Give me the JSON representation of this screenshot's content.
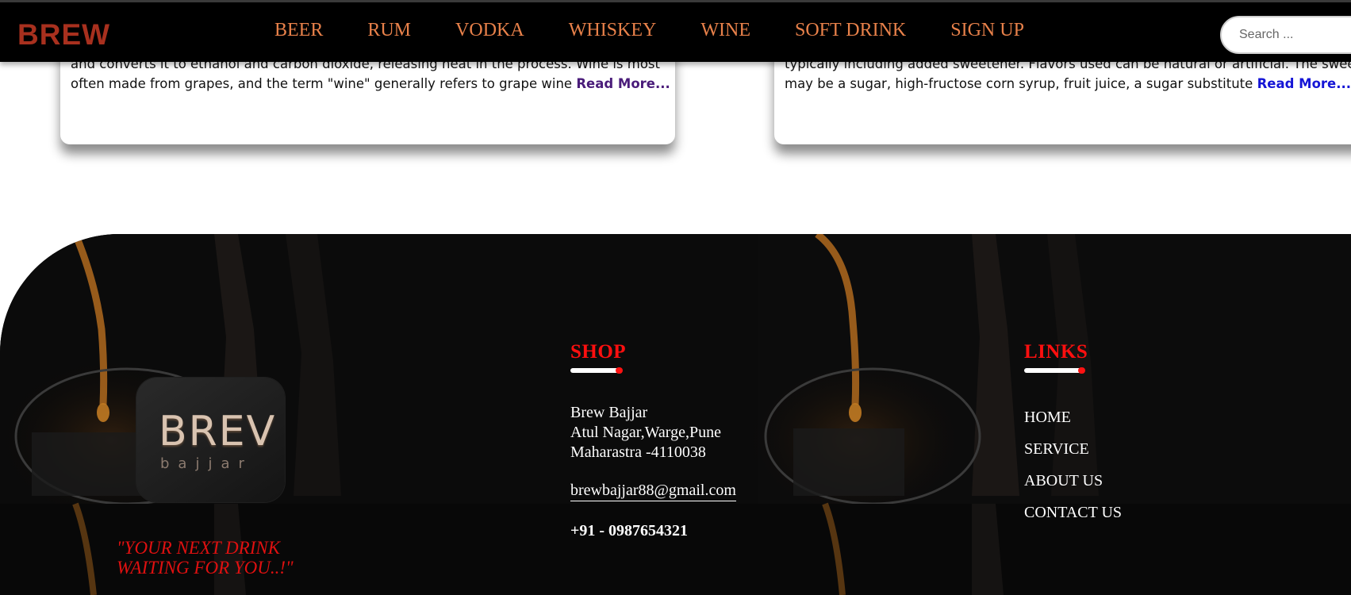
{
  "navbar": {
    "brand": "BREW",
    "links": [
      "BEER",
      "RUM",
      "VODKA",
      "WHISKEY",
      "WINE",
      "SOFT DRINK",
      "SIGN UP"
    ],
    "search_placeholder": "Search ..."
  },
  "cards": {
    "left": {
      "line1": "and converts it to ethanol and carbon dioxide, releasing heat in the process. Wine is most",
      "line2": "often made from grapes, and the term \"wine\" generally refers to grape wine",
      "read_more": "Read More..."
    },
    "right": {
      "line1": "typically including added sweetener. Flavors used can be natural or artificial. The sweetener",
      "line2": "may be a sugar, high-fructose corn syrup, fruit juice, a sugar substitute",
      "read_more": "Read More..."
    }
  },
  "footer": {
    "logo_main": "BREV",
    "logo_sub": "bajjar",
    "tagline_line1": "\"YOUR NEXT DRINK",
    "tagline_line2": "WAITING FOR YOU..!\"",
    "shop": {
      "heading": "SHOP",
      "address_line1": "Brew Bajjar",
      "address_line2": "Atul Nagar,Warge,Pune",
      "address_line3": "Maharastra -4110038",
      "email": "brewbajjar88@gmail.com",
      "phone": "+91 - 0987654321"
    },
    "links": {
      "heading": "LINKS",
      "items": [
        "HOME",
        "SERVICE",
        "ABOUT US",
        "CONTACT US"
      ]
    }
  },
  "colors": {
    "navbar_bg": "#000000",
    "brand": "#a8301e",
    "nav_link": "#e8814a",
    "footer_heading": "#ff0f0f",
    "tagline": "#e01010"
  }
}
